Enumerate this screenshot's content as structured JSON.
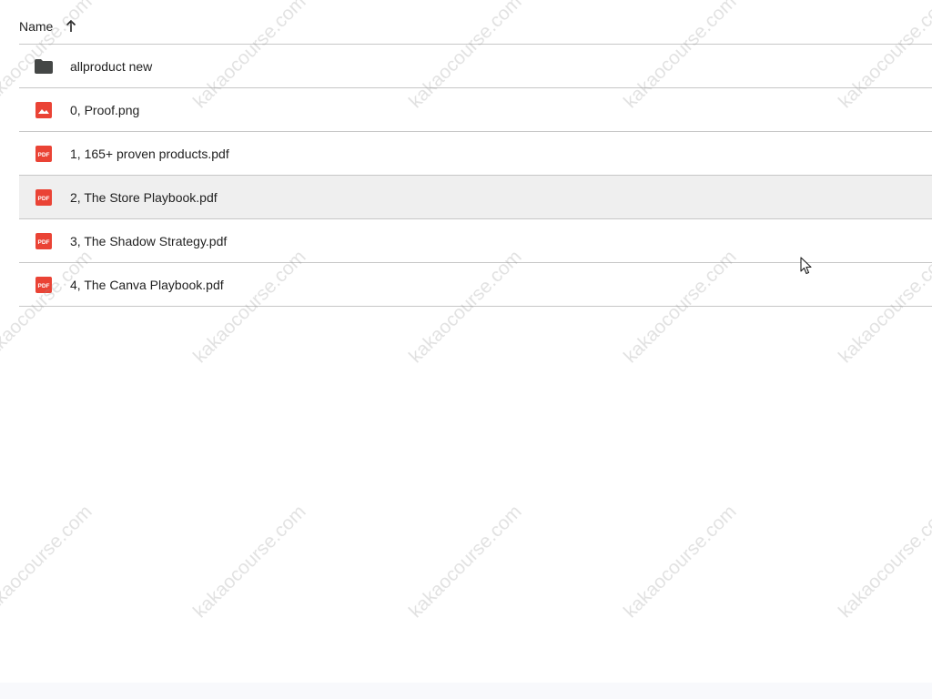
{
  "header": {
    "name_label": "Name",
    "sort_icon": "arrow-up-icon"
  },
  "files": [
    {
      "name": "allproduct new",
      "type": "folder",
      "icon": "folder-icon",
      "selected": false
    },
    {
      "name": "0, Proof.png",
      "type": "image",
      "icon": "image-icon",
      "selected": false
    },
    {
      "name": "1, 165+ proven products.pdf",
      "type": "pdf",
      "icon": "pdf-icon",
      "selected": false
    },
    {
      "name": "2, The Store Playbook.pdf",
      "type": "pdf",
      "icon": "pdf-icon",
      "selected": true
    },
    {
      "name": "3, The Shadow Strategy.pdf",
      "type": "pdf",
      "icon": "pdf-icon",
      "selected": false
    },
    {
      "name": "4, The Canva Playbook.pdf",
      "type": "pdf",
      "icon": "pdf-icon",
      "selected": false
    }
  ],
  "icon_labels": {
    "pdf": "PDF"
  },
  "watermark": "kakaocourse.com",
  "colors": {
    "pdf_red": "#ea4335",
    "folder_gray": "#444746",
    "selected_row": "#efefef",
    "divider": "#c7c7c7"
  }
}
